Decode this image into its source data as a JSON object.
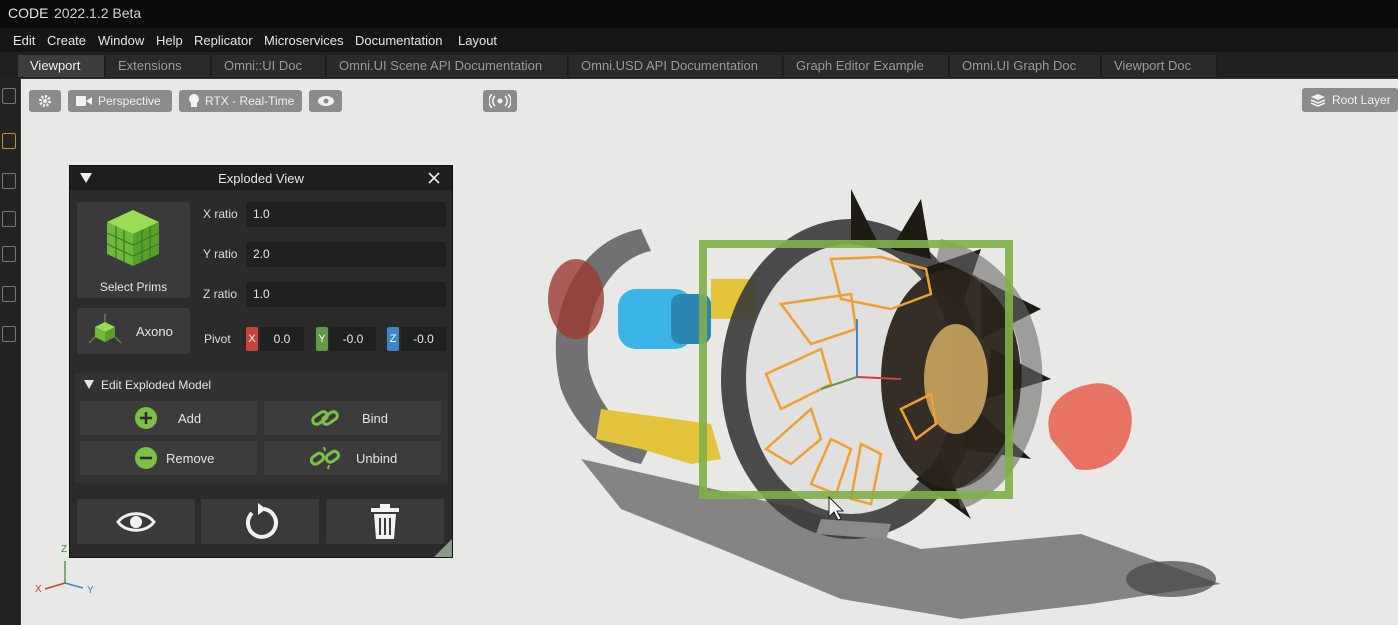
{
  "app": {
    "name": "CODE",
    "version": "2022.1.2 Beta"
  },
  "menu": [
    "Edit",
    "Create",
    "Window",
    "Help",
    "Replicator",
    "Microservices",
    "Documentation",
    "Layout"
  ],
  "tabs": [
    {
      "label": "Viewport",
      "active": true
    },
    {
      "label": "Extensions",
      "active": false
    },
    {
      "label": "Omni::UI Doc",
      "active": false
    },
    {
      "label": "Omni.UI Scene API Documentation",
      "active": false
    },
    {
      "label": "Omni.USD API Documentation",
      "active": false
    },
    {
      "label": "Graph Editor Example",
      "active": false
    },
    {
      "label": "Omni.UI Graph Doc",
      "active": false
    },
    {
      "label": "Viewport Doc",
      "active": false
    }
  ],
  "viewport": {
    "settings_icon": "gear-icon",
    "camera_label": "Perspective",
    "render_label": "RTX - Real-Time",
    "visibility_icon": "eye-icon",
    "broadcast_icon": "broadcast-icon",
    "layer_label": "Root Layer",
    "axis_labels": {
      "x": "X",
      "y": "Y",
      "z": "Z"
    }
  },
  "exploded_view": {
    "title": "Exploded View",
    "select_prims_label": "Select Prims",
    "axono_label": "Axono",
    "x_ratio": {
      "label": "X ratio",
      "value": "1.0"
    },
    "y_ratio": {
      "label": "Y ratio",
      "value": "2.0"
    },
    "z_ratio": {
      "label": "Z ratio",
      "value": "1.0"
    },
    "pivot": {
      "label": "Pivot",
      "x": {
        "axis": "X",
        "value": "0.0"
      },
      "y": {
        "axis": "Y",
        "value": "-0.0"
      },
      "z": {
        "axis": "Z",
        "value": "-0.0"
      }
    },
    "section_title": "Edit Exploded Model",
    "buttons": {
      "add": "Add",
      "bind": "Bind",
      "remove": "Remove",
      "unbind": "Unbind"
    },
    "footer_icons": [
      "eye-icon",
      "reset-icon",
      "trash-icon"
    ]
  },
  "colors": {
    "accent_x": "#c8433b",
    "accent_y": "#5e9a49",
    "accent_z": "#3f86c8",
    "selection": "#7fb04a",
    "highlight": "#f0a030"
  }
}
